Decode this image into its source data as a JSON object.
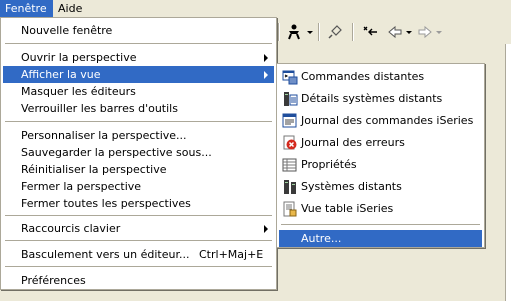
{
  "menubar": {
    "items": [
      "Fenêtre",
      "Aide"
    ]
  },
  "menu": {
    "nouvelle_fenetre": "Nouvelle fenêtre",
    "ouvrir_perspective": "Ouvrir la perspective",
    "afficher_vue": "Afficher la vue",
    "masquer_editeurs": "Masquer les éditeurs",
    "verrouiller_barres": "Verrouiller les barres d'outils",
    "personnaliser_perspective": "Personnaliser la perspective...",
    "sauvegarder_perspective": "Sauvegarder la perspective sous...",
    "reinitialiser_perspective": "Réinitialiser la perspective",
    "fermer_perspective": "Fermer la perspective",
    "fermer_toutes_perspectives": "Fermer toutes les perspectives",
    "raccourcis_clavier": "Raccourcis clavier",
    "basculement_editeur": "Basculement vers un éditeur...",
    "basculement_shortcut": "Ctrl+Maj+E",
    "preferences": "Préférences"
  },
  "submenu": {
    "items": [
      {
        "label": "Commandes distantes",
        "icon": "remote-commands-icon"
      },
      {
        "label": "Détails systèmes distants",
        "icon": "remote-system-details-icon"
      },
      {
        "label": "Journal des commandes iSeries",
        "icon": "iseries-command-log-icon"
      },
      {
        "label": "Journal des erreurs",
        "icon": "error-log-icon"
      },
      {
        "label": "Propriétés",
        "icon": "properties-icon"
      },
      {
        "label": "Systèmes distants",
        "icon": "remote-systems-icon"
      },
      {
        "label": "Vue table iSeries",
        "icon": "iseries-table-view-icon"
      }
    ],
    "autre": "Autre..."
  },
  "colors": {
    "highlight": "#316ac5",
    "menu_bg": "#ffffff",
    "chrome": "#ece9d8"
  }
}
